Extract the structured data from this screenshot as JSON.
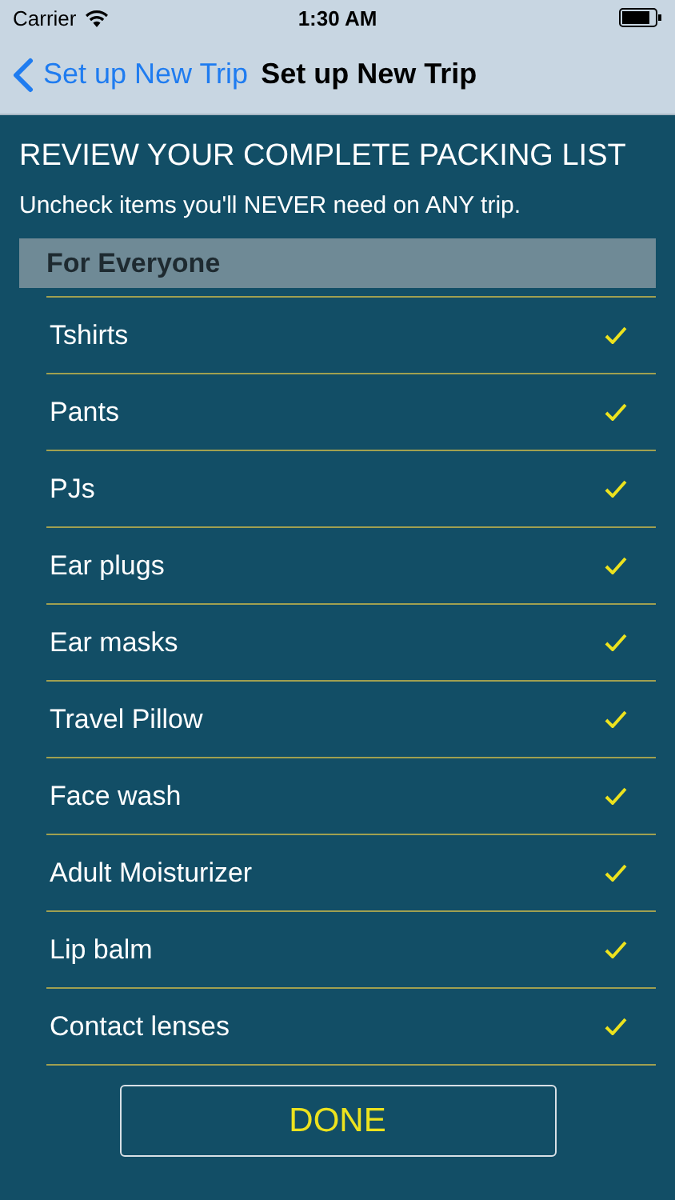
{
  "status_bar": {
    "carrier": "Carrier",
    "time": "1:30 AM"
  },
  "nav": {
    "back": "Set up New Trip",
    "title": "Set up New Trip"
  },
  "heading": "REVIEW YOUR COMPLETE PACKING LIST",
  "instruction": "Uncheck items you'll NEVER need on ANY trip.",
  "section": {
    "title": "For Everyone",
    "items": [
      {
        "label": "Tshirts",
        "checked": true
      },
      {
        "label": "Pants",
        "checked": true
      },
      {
        "label": "PJs",
        "checked": true
      },
      {
        "label": "Ear plugs",
        "checked": true
      },
      {
        "label": "Ear masks",
        "checked": true
      },
      {
        "label": "Travel Pillow",
        "checked": true
      },
      {
        "label": "Face wash",
        "checked": true
      },
      {
        "label": "Adult Moisturizer",
        "checked": true
      },
      {
        "label": "Lip balm",
        "checked": true
      },
      {
        "label": "Contact lenses",
        "checked": true
      }
    ]
  },
  "done_button": "DONE"
}
